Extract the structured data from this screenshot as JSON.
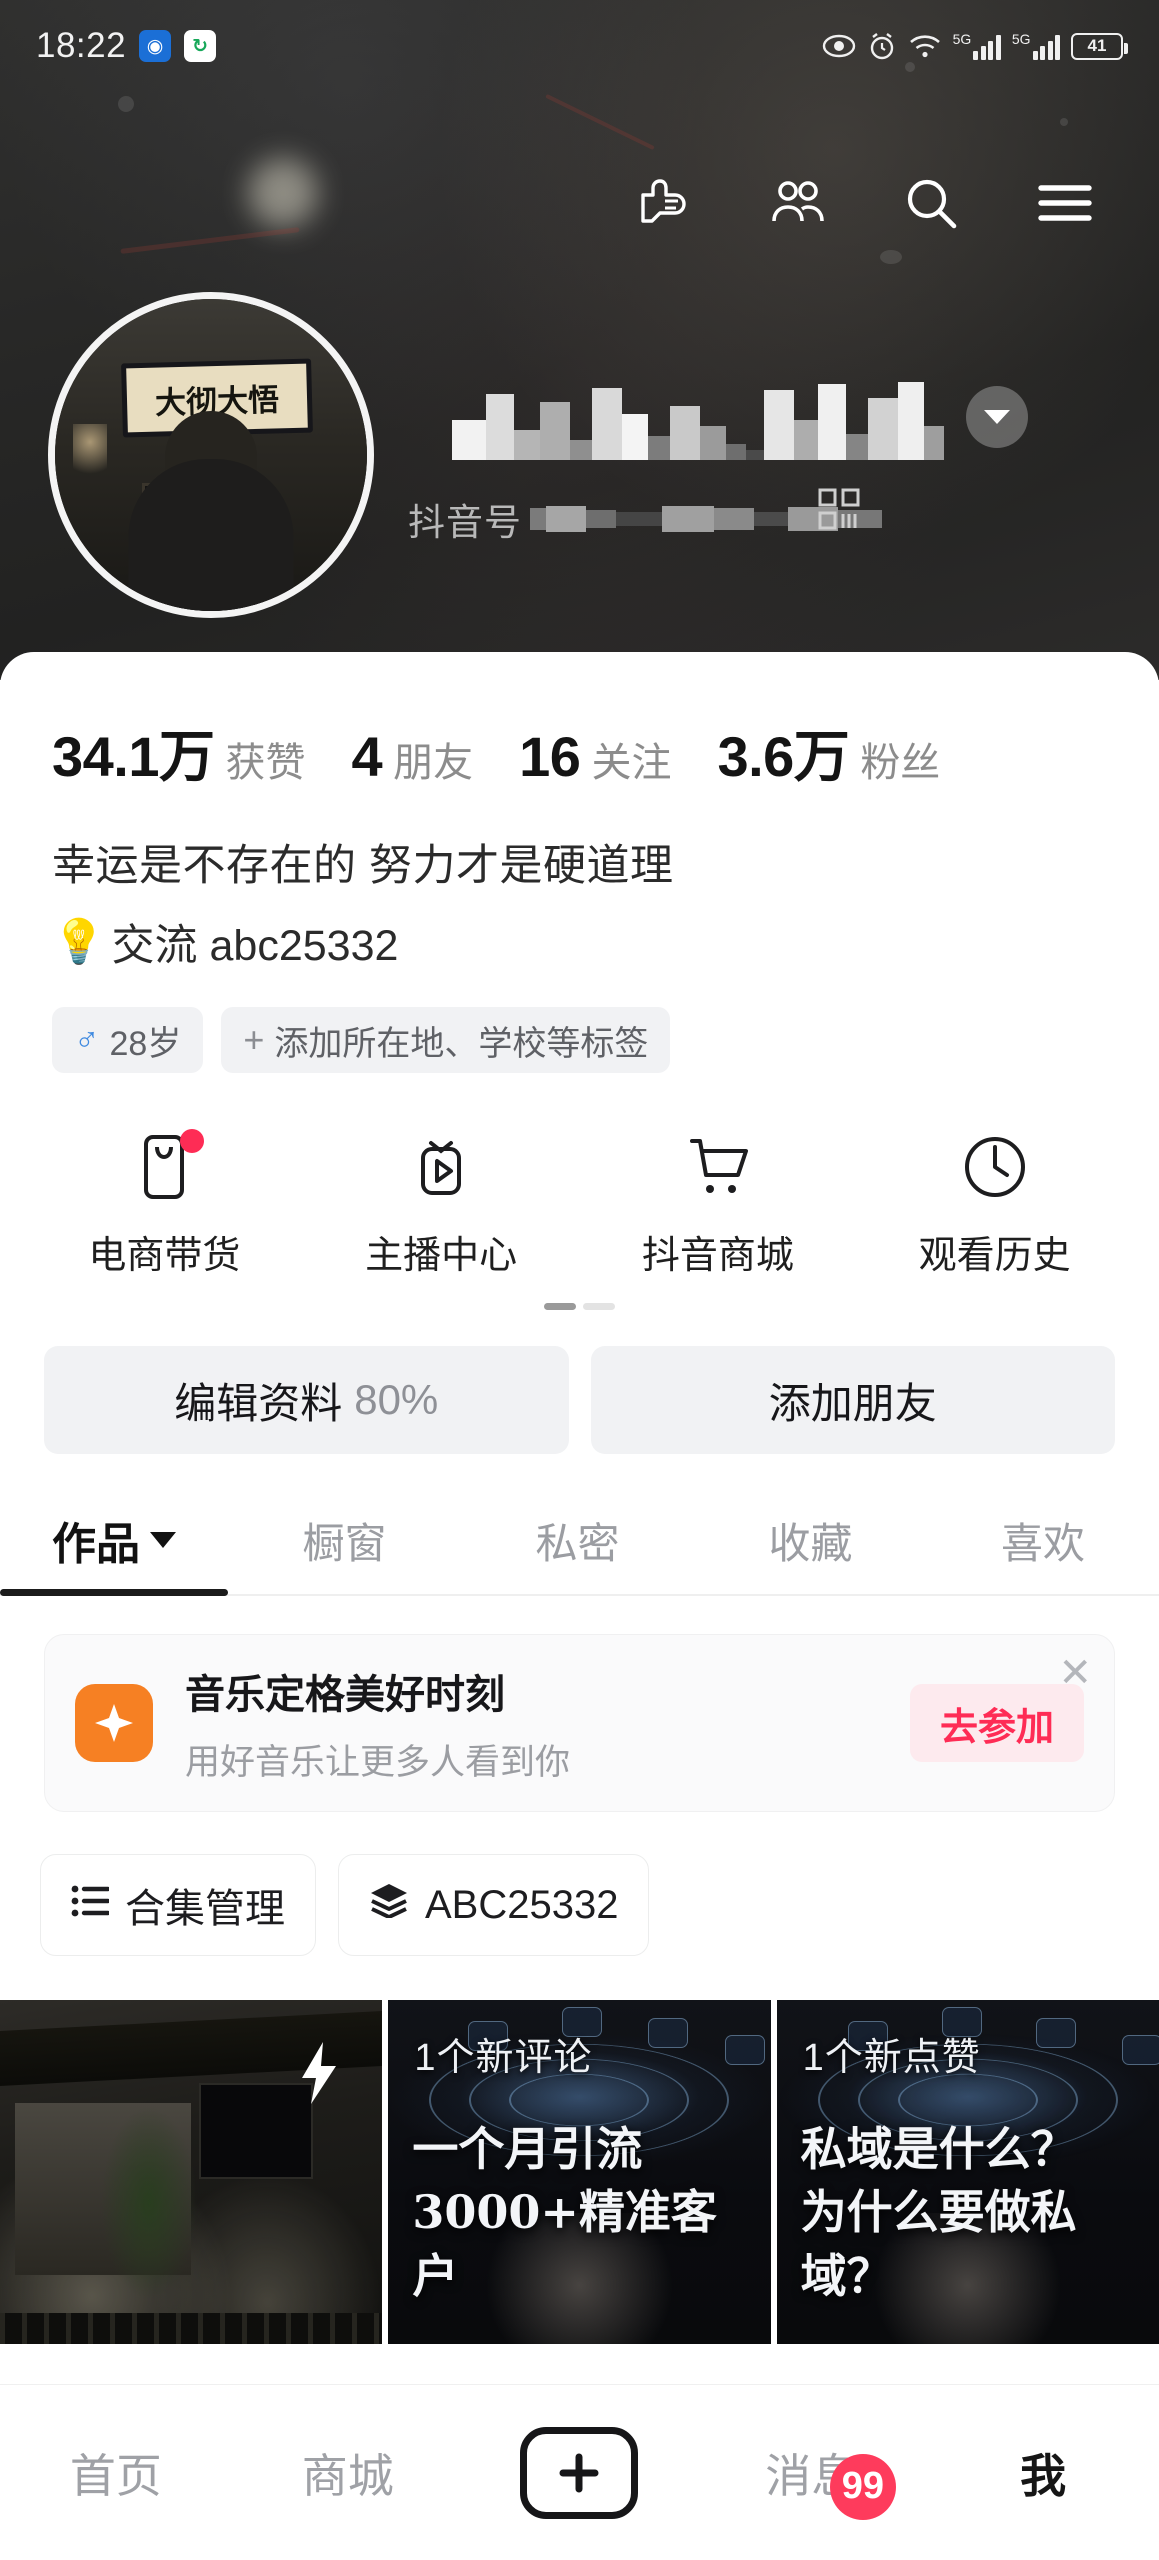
{
  "statusbar": {
    "time": "18:22",
    "app_icons": [
      "camera-app-icon",
      "sync-app-icon"
    ],
    "eye_icon": "eye-icon",
    "alarm_icon": "alarm-icon",
    "wifi_icon": "wifi-icon",
    "network_label_1": "5G",
    "network_label_2": "5G",
    "battery_level": "41"
  },
  "topnav": {
    "items": [
      {
        "name": "pointing-hand-icon",
        "label": ""
      },
      {
        "name": "friends-icon",
        "label": ""
      },
      {
        "name": "search-icon",
        "label": ""
      },
      {
        "name": "menu-icon",
        "label": ""
      }
    ]
  },
  "profile": {
    "avatar_sign_text": "大彻大悟",
    "username_redacted": true,
    "douyin_id_label": "抖音号",
    "douyin_id_redacted": true,
    "qr_icon": "qr-code-icon",
    "dropdown_icon": "chevron-down-icon"
  },
  "stats": [
    {
      "num": "34.1万",
      "label": "获赞"
    },
    {
      "num": "4",
      "label": "朋友"
    },
    {
      "num": "16",
      "label": "关注"
    },
    {
      "num": "3.6万",
      "label": "粉丝"
    }
  ],
  "bio": {
    "line1": "幸运是不存在的 努力才是硬道理",
    "line2_emoji": "💡",
    "line2": "交流 abc25332"
  },
  "tags": {
    "gender_symbol": "♂",
    "age": "28岁",
    "add_plus": "+",
    "add_label": "添加所在地、学校等标签"
  },
  "quick_actions": [
    {
      "icon": "ecommerce-bag-icon",
      "label": "电商带货",
      "badge": true
    },
    {
      "icon": "live-center-tv-icon",
      "label": "主播中心",
      "badge": false
    },
    {
      "icon": "shopping-cart-icon",
      "label": "抖音商城",
      "badge": false
    },
    {
      "icon": "watch-history-clock-icon",
      "label": "观看历史",
      "badge": false
    }
  ],
  "pager": {
    "total": 2,
    "active": 0
  },
  "actions": {
    "edit_label": "编辑资料",
    "edit_percent": "80%",
    "add_friend_label": "添加朋友"
  },
  "tabs": [
    {
      "label": "作品",
      "active": true,
      "has_caret": true
    },
    {
      "label": "橱窗",
      "active": false,
      "has_caret": false
    },
    {
      "label": "私密",
      "active": false,
      "has_caret": false
    },
    {
      "label": "收藏",
      "active": false,
      "has_caret": false
    },
    {
      "label": "喜欢",
      "active": false,
      "has_caret": false
    }
  ],
  "promo": {
    "icon": "sparkle-icon",
    "title": "音乐定格美好时刻",
    "subtitle": "用好音乐让更多人看到你",
    "button_label": "去参加",
    "close_icon": "close-icon",
    "button_color": "#fe2c55",
    "icon_color": "#f68023"
  },
  "chips": [
    {
      "icon": "list-icon",
      "label": "合集管理"
    },
    {
      "icon": "layers-icon",
      "label": "ABC25332"
    }
  ],
  "grid": [
    {
      "badge": "",
      "title": "",
      "overlay_icon": "lightning-bolt-icon"
    },
    {
      "badge": "1个新评论",
      "title": "一个月引流\n3000+精准客户",
      "overlay_icon": ""
    },
    {
      "badge": "1个新点赞",
      "title": "私域是什么？\n为什么要做私域？",
      "overlay_icon": ""
    }
  ],
  "bottomnav": [
    {
      "label": "首页",
      "active": false,
      "badge": ""
    },
    {
      "label": "商城",
      "active": false,
      "badge": ""
    },
    {
      "label": "",
      "active": false,
      "badge": "",
      "icon": "plus-icon"
    },
    {
      "label": "消息",
      "active": false,
      "badge": "99"
    },
    {
      "label": "我",
      "active": true,
      "badge": ""
    }
  ]
}
